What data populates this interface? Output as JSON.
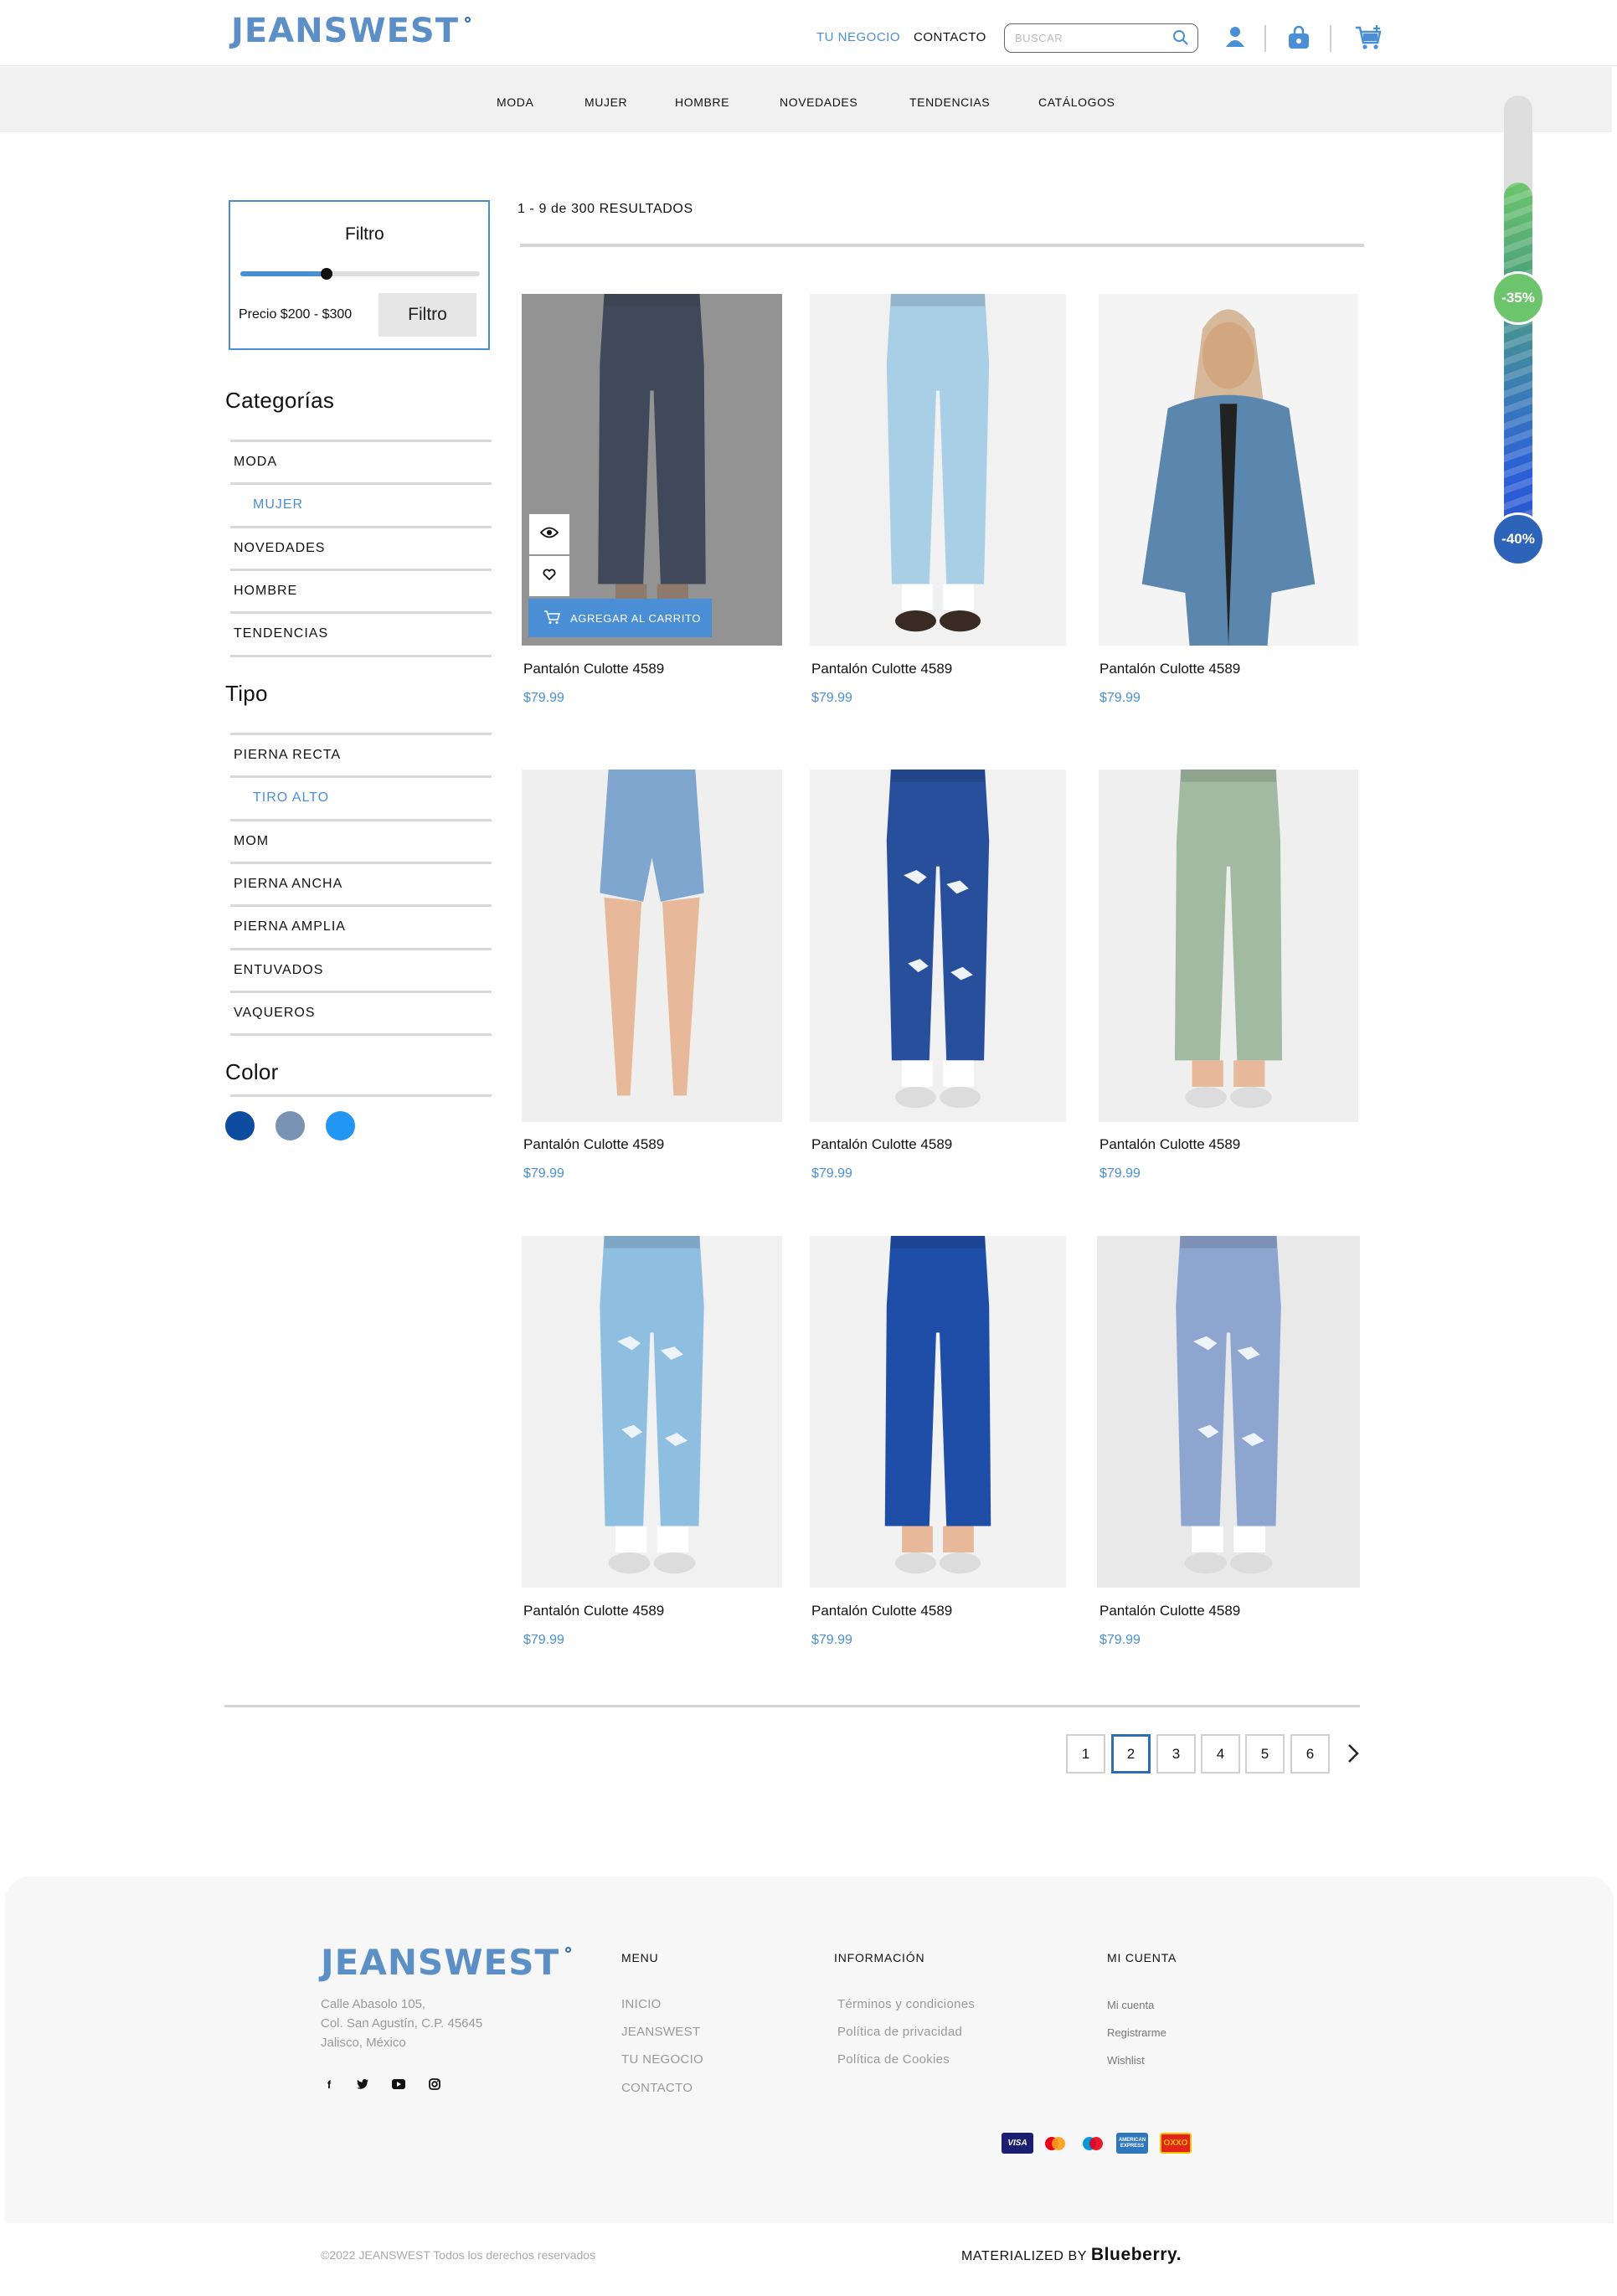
{
  "header": {
    "brand": "JEANSWEST",
    "links": {
      "business": "TU NEGOCIO",
      "contact": "CONTACTO"
    },
    "search_placeholder": "BUSCAR",
    "accent": "#4a8fd6"
  },
  "nav": [
    "MODA",
    "MUJER",
    "HOMBRE",
    "NOVEDADES",
    "TENDENCIAS",
    "CATÁLOGOS"
  ],
  "filter": {
    "title": "Filtro",
    "price_label": "Precio $200 - $300",
    "button": "Filtro",
    "slider_value": 0.36
  },
  "categories": {
    "title": "Categorías",
    "items": [
      {
        "label": "MODA"
      },
      {
        "label": "MUJER",
        "active": true
      },
      {
        "label": "NOVEDADES"
      },
      {
        "label": "HOMBRE"
      },
      {
        "label": "TENDENCIAS"
      }
    ]
  },
  "types": {
    "title": "Tipo",
    "items": [
      {
        "label": "PIERNA RECTA"
      },
      {
        "label": "TIRO ALTO",
        "active": true
      },
      {
        "label": "MOM"
      },
      {
        "label": "PIERNA ANCHA"
      },
      {
        "label": "PIERNA AMPLIA"
      },
      {
        "label": "ENTUVADOS"
      },
      {
        "label": "VAQUEROS"
      }
    ]
  },
  "colors": {
    "title": "Color",
    "swatches": [
      "#0d4c9e",
      "#7a93b4",
      "#2196f3"
    ]
  },
  "results": {
    "text": "1 - 9 de 300 RESULTADOS"
  },
  "products": [
    {
      "name": "Pantalón Culotte 4589",
      "price": "$79.99",
      "image": "skinny-jeans-dark"
    },
    {
      "name": "Pantalón Culotte 4589",
      "price": "$79.99",
      "image": "jogger-jeans-light"
    },
    {
      "name": "Pantalón Culotte 4589",
      "price": "$79.99",
      "image": "denim-jacket"
    },
    {
      "name": "Pantalón Culotte 4589",
      "price": "$79.99",
      "image": "denim-shorts"
    },
    {
      "name": "Pantalón Culotte 4589",
      "price": "$79.99",
      "image": "ripped-jeans-dark"
    },
    {
      "name": "Pantalón Culotte 4589",
      "price": "$79.99",
      "image": "skinny-jeans-sage"
    },
    {
      "name": "Pantalón Culotte 4589",
      "price": "$79.99",
      "image": "ripped-mom-jeans-light"
    },
    {
      "name": "Pantalón Culotte 4589",
      "price": "$79.99",
      "image": "skinny-jeans-blue"
    },
    {
      "name": "Pantalón Culotte 4589",
      "price": "$79.99",
      "image": "ripped-mom-jeans-grey-blue"
    }
  ],
  "card_actions": {
    "add_to_cart": "AGREGAR AL CARRITO"
  },
  "pagination": {
    "pages": [
      "1",
      "2",
      "3",
      "4",
      "5",
      "6"
    ],
    "current": "2"
  },
  "discounts": [
    "-35%",
    "-40%"
  ],
  "footer": {
    "brand": "JEANSWEST",
    "address": [
      "Calle Abasolo 105,",
      "Col. San Agustín, C.P. 45645",
      "Jalisco, México"
    ],
    "social_icons": [
      "facebook-icon",
      "twitter-icon",
      "youtube-icon",
      "instagram-icon"
    ],
    "menu_title": "MENU",
    "menu_items": [
      "INICIO",
      "JEANSWEST",
      "TU NEGOCIO",
      "CONTACTO"
    ],
    "info_title": "INFORMACIÓN",
    "info_items": [
      "Términos y condiciones",
      "Política de privacidad",
      "Política de Cookies"
    ],
    "account_title": "MI CUENTA",
    "account_items": [
      "Mi cuenta",
      "Registrarme",
      "Wishlist"
    ],
    "payment_methods": [
      "VISA",
      "mastercard",
      "maestro",
      "AMERICAN EXPRESS",
      "OXXO"
    ],
    "copyright": "©2022 JEANSWEST Todos los derechos reservados",
    "credit_prefix": "MATERIALIZED BY",
    "credit_brand": "Blueberry."
  }
}
